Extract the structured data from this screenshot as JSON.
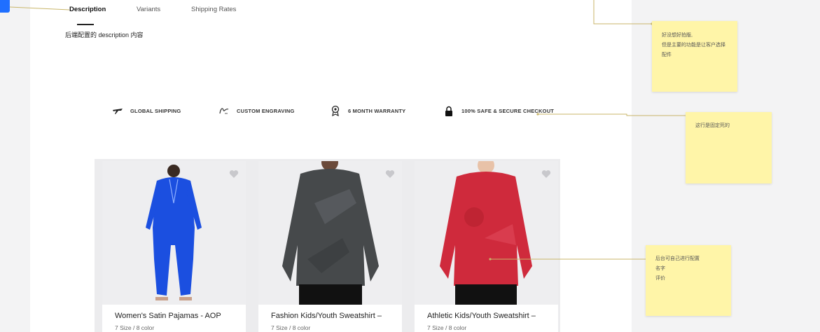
{
  "tabs": [
    {
      "label": "Description",
      "active": true
    },
    {
      "label": "Variants",
      "active": false
    },
    {
      "label": "Shipping Rates",
      "active": false
    }
  ],
  "description_text": "后端配置的 description 内容",
  "features": [
    {
      "label": "GLOBAL SHIPPING",
      "icon": "airplane-icon"
    },
    {
      "label": "CUSTOM ENGRAVING",
      "icon": "engraving-icon"
    },
    {
      "label": "6 MONTH WARRANTY",
      "icon": "warranty-badge-icon"
    },
    {
      "label": "100% SAFE & SECURE CHECKOUT",
      "icon": "lock-icon"
    }
  ],
  "products": [
    {
      "title": "Women's Satin Pajamas - AOP",
      "meta": "7 Size  / 8 color",
      "color": "#1b4fe0"
    },
    {
      "title": "Fashion Kids/Youth Sweatshirt –",
      "meta": "7 Size  / 8 color",
      "color": "#46494b"
    },
    {
      "title": "Athletic Kids/Youth Sweatshirt –",
      "meta": "7 Size  / 8 color",
      "color": "#cf2a3c"
    }
  ],
  "notes": [
    {
      "lines": [
        "好没想好拍版,",
        "但是主要的功能是让客户选择",
        "配件"
      ]
    },
    {
      "lines": [
        "这行是固定死的"
      ]
    },
    {
      "lines": [
        "后台可自己进行配置",
        "名字",
        "评价"
      ]
    }
  ],
  "colors": {
    "accent": "#1f6fff",
    "sticky": "#fff5a8",
    "connector": "#c9b66a"
  }
}
